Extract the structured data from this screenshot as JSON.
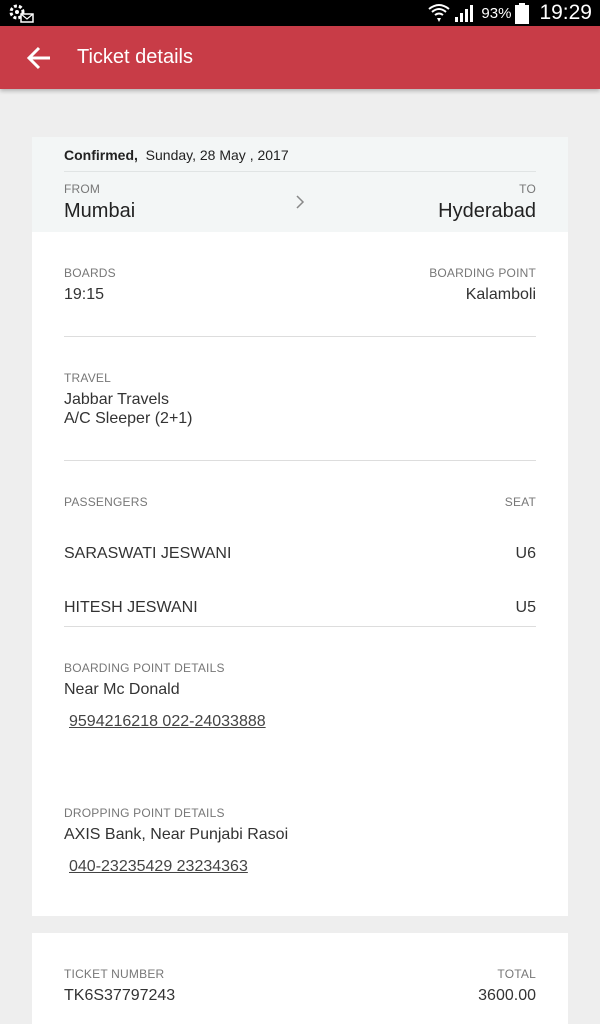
{
  "status_bar": {
    "battery": "93%",
    "time": "19:29"
  },
  "app_bar": {
    "title": "Ticket details"
  },
  "trip": {
    "status": "Confirmed,",
    "date": "Sunday, 28 May , 2017",
    "from_label": "FROM",
    "from_city": "Mumbai",
    "to_label": "TO",
    "to_city": "Hyderabad"
  },
  "boarding": {
    "boards_label": "BOARDS",
    "boards_time": "19:15",
    "point_label": "BOARDING POINT",
    "point_value": "Kalamboli"
  },
  "travel": {
    "label": "TRAVEL",
    "operator": "Jabbar  Travels",
    "bus_type": "A/C Sleeper (2+1)"
  },
  "passengers": {
    "label": "PASSENGERS",
    "seat_label": "SEAT",
    "list": [
      {
        "name": "SARASWATI JESWANI",
        "seat": "U6"
      },
      {
        "name": "HITESH JESWANI",
        "seat": "U5"
      }
    ]
  },
  "boarding_point_details": {
    "label": "BOARDING POINT DETAILS",
    "address": "Near Mc Donald",
    "phones": "9594216218 022-24033888"
  },
  "dropping_point_details": {
    "label": "DROPPING POINT DETAILS",
    "address": "AXIS Bank, Near Punjabi Rasoi",
    "phones": "040-23235429 23234363"
  },
  "ticket": {
    "number_label": "TICKET NUMBER",
    "number": "TK6S37797243",
    "total_label": "TOTAL",
    "total": "3600.00"
  },
  "colors": {
    "app_bar": "#c83c47",
    "route_bg": "#f3f6f6",
    "page_bg": "#eeeeee"
  },
  "icons": [
    "settings-mail-icon",
    "wifi-icon",
    "signal-icon",
    "battery-icon",
    "back-arrow-icon",
    "chevron-right-icon"
  ]
}
